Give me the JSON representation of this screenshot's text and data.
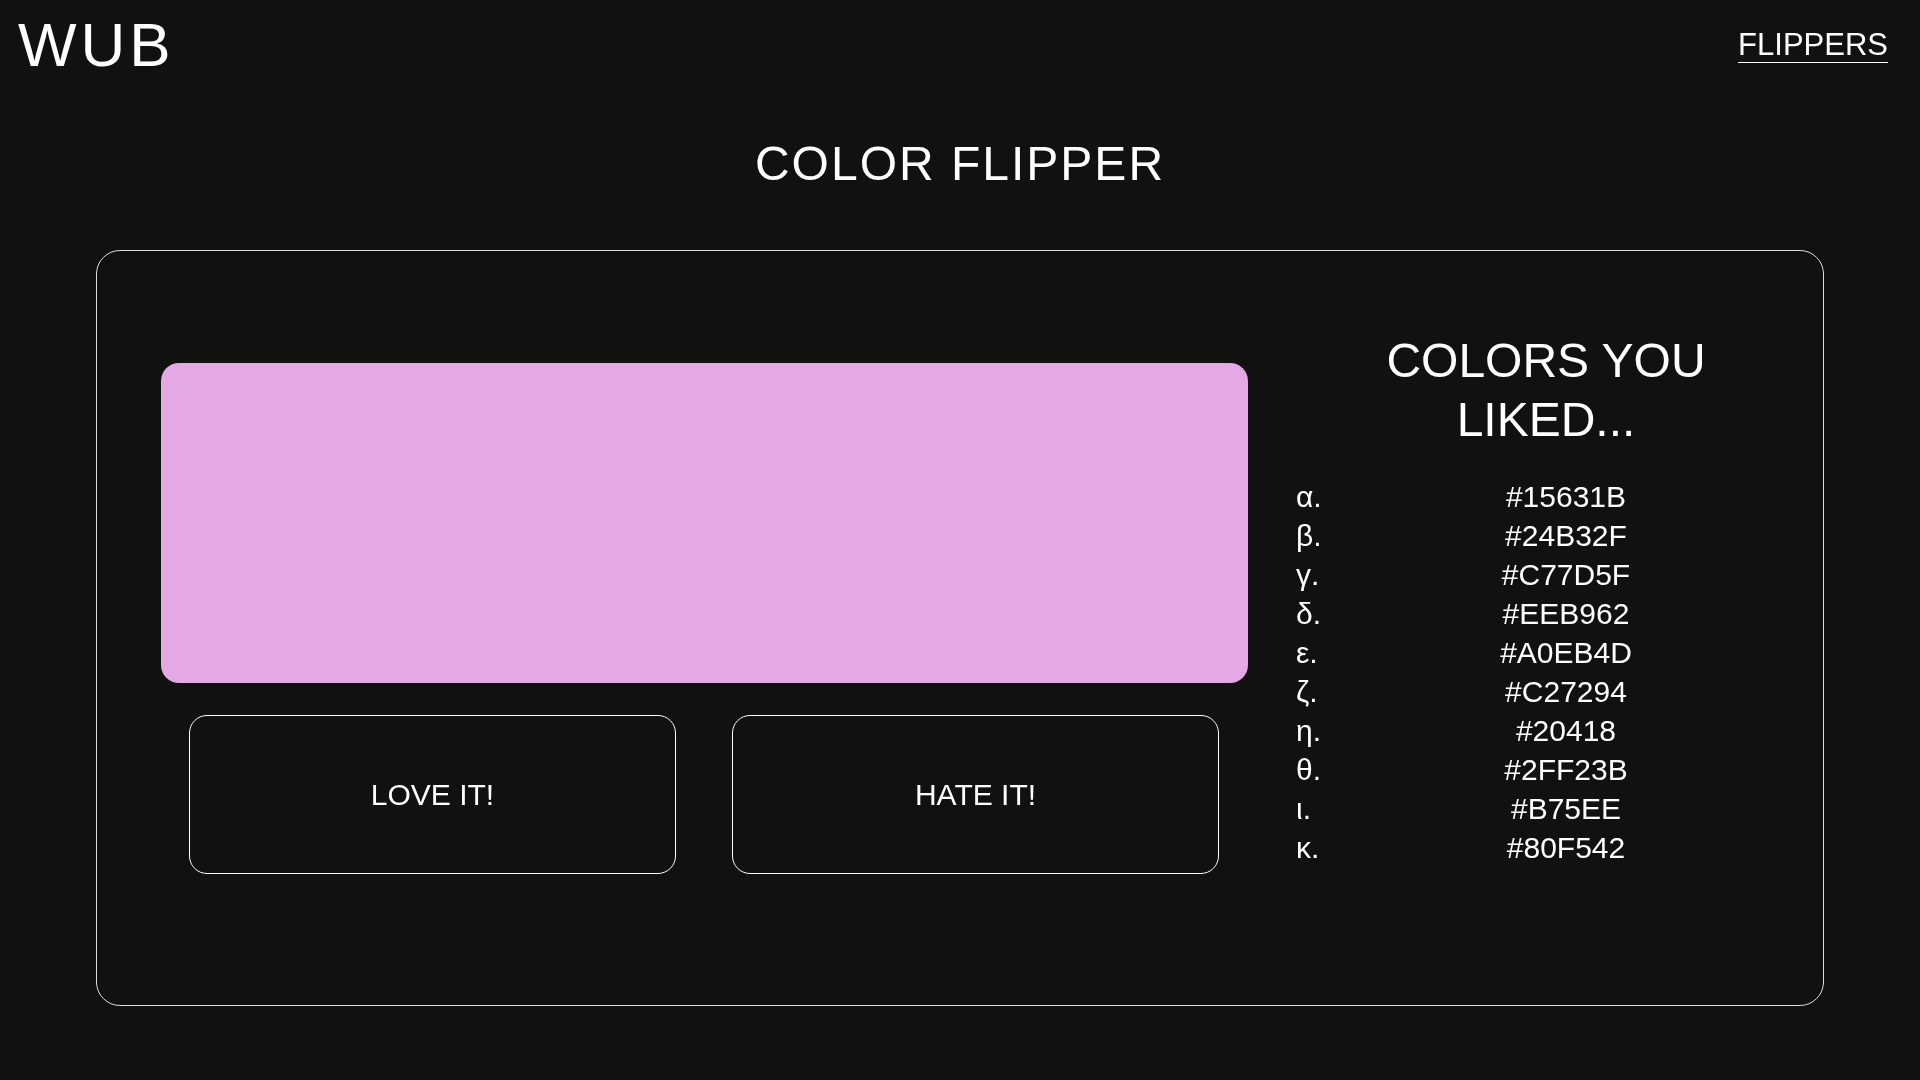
{
  "header": {
    "logo": "WUB",
    "nav_link": "FLIPPERS"
  },
  "title": "COLOR FLIPPER",
  "swatch": {
    "color": "#e4a9e4"
  },
  "buttons": [
    "LOVE IT!",
    "HATE IT!"
  ],
  "liked": {
    "heading": "COLORS YOU LIKED...",
    "items": [
      {
        "marker": "α.",
        "hex": "#15631B"
      },
      {
        "marker": "β.",
        "hex": "#24B32F"
      },
      {
        "marker": "γ.",
        "hex": "#C77D5F"
      },
      {
        "marker": "δ.",
        "hex": "#EEB962"
      },
      {
        "marker": "ε.",
        "hex": "#A0EB4D"
      },
      {
        "marker": "ζ.",
        "hex": "#C27294"
      },
      {
        "marker": "η.",
        "hex": "#20418"
      },
      {
        "marker": "θ.",
        "hex": "#2FF23B"
      },
      {
        "marker": "ι.",
        "hex": "#B75EE"
      },
      {
        "marker": "κ.",
        "hex": "#80F542"
      }
    ]
  }
}
